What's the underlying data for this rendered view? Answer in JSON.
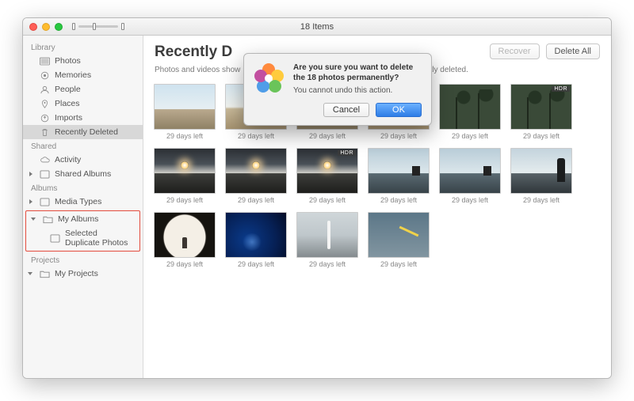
{
  "window": {
    "title": "18 Items"
  },
  "sidebar": {
    "sections": {
      "library": {
        "heading": "Library",
        "photos": {
          "label": "Photos"
        },
        "memories": {
          "label": "Memories"
        },
        "people": {
          "label": "People"
        },
        "places": {
          "label": "Places"
        },
        "imports": {
          "label": "Imports"
        },
        "recently_deleted": {
          "label": "Recently Deleted",
          "selected": true
        }
      },
      "shared": {
        "heading": "Shared",
        "activity": {
          "label": "Activity"
        },
        "shared_albums": {
          "label": "Shared Albums"
        }
      },
      "albums": {
        "heading": "Albums",
        "media_types": {
          "label": "Media Types"
        },
        "my_albums": {
          "label": "My Albums"
        },
        "selected_duplicate_photos": {
          "label": "Selected Duplicate Photos",
          "highlighted": true
        }
      },
      "projects": {
        "heading": "Projects",
        "my_projects": {
          "label": "My Projects"
        }
      }
    }
  },
  "main": {
    "title": "Recently Deleted",
    "title_visible": "Recently D",
    "subtitle_full": "Photos and videos show the days remaining before deletion. After that time, items will be permanently deleted.",
    "subtitle_left": "Photos and videos show",
    "subtitle_right": "ntly deleted.",
    "recover_label": "Recover",
    "delete_all_label": "Delete All",
    "thumb_caption": "29 days left",
    "hdr_badge": "HDR",
    "grid": [
      {
        "style": "sky",
        "hdr": false
      },
      {
        "style": "sky2",
        "hdr": false
      },
      {
        "style": "sky",
        "hdr": false
      },
      {
        "style": "sky2",
        "hdr": false
      },
      {
        "style": "palm",
        "hdr": false
      },
      {
        "style": "palm",
        "hdr": true
      },
      {
        "style": "sunset",
        "hdr": false
      },
      {
        "style": "sunset",
        "hdr": false
      },
      {
        "style": "sunset",
        "hdr": true
      },
      {
        "style": "boat",
        "hdr": false
      },
      {
        "style": "boat",
        "hdr": false
      },
      {
        "style": "person",
        "hdr": false
      },
      {
        "style": "tunnel",
        "hdr": false
      },
      {
        "style": "aqua",
        "hdr": false
      },
      {
        "style": "surf",
        "hdr": false
      },
      {
        "style": "kite",
        "hdr": false
      }
    ]
  },
  "dialog": {
    "title": "Are you sure you want to delete the 18 photos permanently?",
    "message": "You cannot undo this action.",
    "cancel_label": "Cancel",
    "ok_label": "OK"
  }
}
